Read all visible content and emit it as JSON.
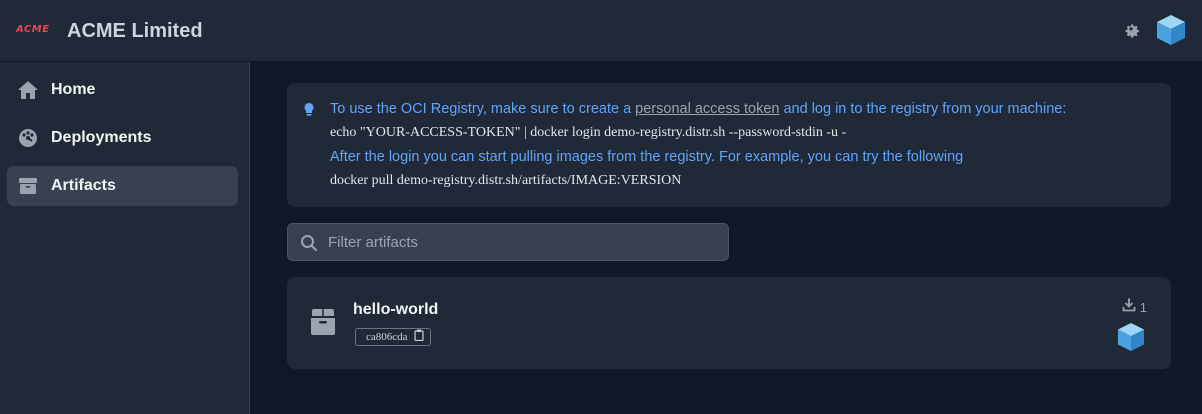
{
  "header": {
    "logo_text": "ACME",
    "company_name": "ACME Limited",
    "settings_icon": "gear-icon",
    "avatar_icon": "cube-avatar-icon"
  },
  "sidebar": {
    "items": [
      {
        "label": "Home",
        "icon": "home-icon",
        "active": false
      },
      {
        "label": "Deployments",
        "icon": "deployments-icon",
        "active": false
      },
      {
        "label": "Artifacts",
        "icon": "package-icon",
        "active": true
      }
    ]
  },
  "info": {
    "line1_prefix": "To use the OCI Registry, make sure to create a ",
    "line1_link": "personal access token",
    "line1_suffix": " and log in to the registry from your machine:",
    "login_command": "echo \"YOUR-ACCESS-TOKEN\" | docker login demo-registry.distr.sh --password-stdin -u -",
    "line3": "After the login you can start pulling images from the registry. For example, you can try the following",
    "pull_command": "docker pull demo-registry.distr.sh/artifacts/IMAGE:VERSION"
  },
  "search": {
    "placeholder": "Filter artifacts",
    "value": ""
  },
  "artifacts": [
    {
      "name": "hello-world",
      "digest": "ca806cda",
      "downloads": "1"
    }
  ],
  "colors": {
    "accent_blue": "#60a5fa",
    "logo_red": "#e5484d",
    "cube_blue": "#4aa3e0"
  }
}
